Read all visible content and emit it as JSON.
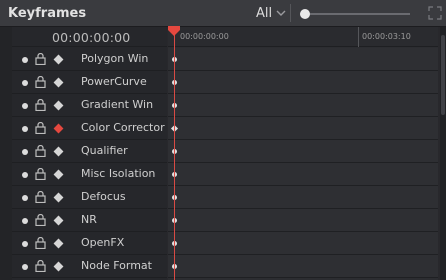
{
  "panel": {
    "title": "Keyframes",
    "filter_value": "All",
    "zoom_level": 0.0
  },
  "timecode": "00:00:00:00",
  "ruler": {
    "start_label": "00:00:00:00",
    "end_label": "00:00:03:10"
  },
  "tracks": [
    {
      "label": "Polygon Win",
      "active": false
    },
    {
      "label": "PowerCurve",
      "active": false
    },
    {
      "label": "Gradient Win",
      "active": false
    },
    {
      "label": "Color Corrector",
      "active": true
    },
    {
      "label": "Qualifier",
      "active": false
    },
    {
      "label": "Misc Isolation",
      "active": false
    },
    {
      "label": "Defocus",
      "active": false
    },
    {
      "label": "NR",
      "active": false
    },
    {
      "label": "OpenFX",
      "active": false
    },
    {
      "label": "Node Format",
      "active": false
    }
  ],
  "colors": {
    "accent": "#e5483f",
    "playhead": "#d84a44"
  },
  "icons": {
    "visibility": "dot-icon",
    "lock": "lock-icon",
    "keyframe": "diamond-icon",
    "filter_dropdown": "chevron-down-icon",
    "expand": "expand-icon"
  }
}
